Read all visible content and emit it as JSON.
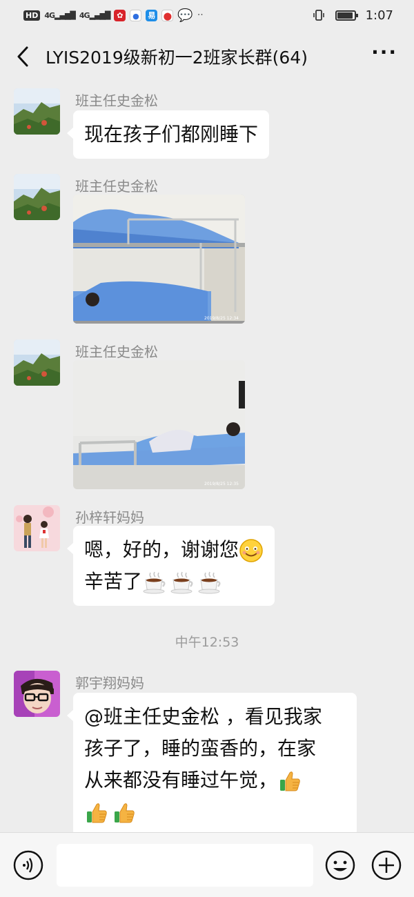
{
  "status_bar": {
    "left_chip": "HD",
    "signal_1": "4G",
    "signal_2": "4G",
    "time": "1:07",
    "battery_level": 0.85,
    "icons": [
      "hd-icon",
      "signal-4g-icon",
      "signal-4g-icon",
      "huawei-app-icon",
      "baidu-app-icon",
      "app-icon",
      "maps-pin-icon",
      "chat-bubble-icon",
      "more-dots-icon",
      "vibrate-icon",
      "battery-icon"
    ]
  },
  "nav": {
    "title": "LYIS2019级新初一2班家长群(64)",
    "back_icon": "back-chevron-icon",
    "more_icon": "more-dots-icon"
  },
  "messages": [
    {
      "type": "text",
      "sender": "班主任史金松",
      "avatar": "mountain-landscape-avatar",
      "lines": [
        "现在孩子们都刚睡下"
      ]
    },
    {
      "type": "image",
      "sender": "班主任史金松",
      "avatar": "mountain-landscape-avatar",
      "image_stamp": "2019/8/25  12:34",
      "image_subject": "bunk-bed-photo"
    },
    {
      "type": "image",
      "sender": "班主任史金松",
      "avatar": "mountain-landscape-avatar",
      "image_stamp": "2019/8/25  12:35",
      "image_subject": "bed-photo"
    },
    {
      "type": "text",
      "sender": "孙梓轩妈妈",
      "avatar": "illustrated-couple-avatar",
      "lines": [
        "嗯，好的，谢谢您",
        "辛苦了"
      ],
      "emojis": [
        "smile-emoji",
        "coffee-emoji",
        "coffee-emoji",
        "coffee-emoji"
      ]
    },
    {
      "type": "time",
      "text": "中午12:53"
    },
    {
      "type": "text",
      "sender": "郭宇翔妈妈",
      "avatar": "boy-glasses-avatar",
      "lines": [
        "@班主任史金松 ，看见我家",
        "孩子了，睡的蛮香的，在家",
        "从来都没有睡过午觉，",
        ""
      ],
      "emojis": [
        "thumbs-up-emoji",
        "thumbs-up-emoji",
        "thumbs-up-emoji"
      ]
    }
  ],
  "input_bar": {
    "voice_icon": "voice-icon",
    "emoji_icon": "emoji-face-icon",
    "plus_icon": "plus-icon",
    "placeholder": ""
  },
  "colors": {
    "background": "#ededed",
    "bubble": "#ffffff",
    "sender_text": "#8a8a8a",
    "timestamp_text": "#9b9b9b"
  }
}
